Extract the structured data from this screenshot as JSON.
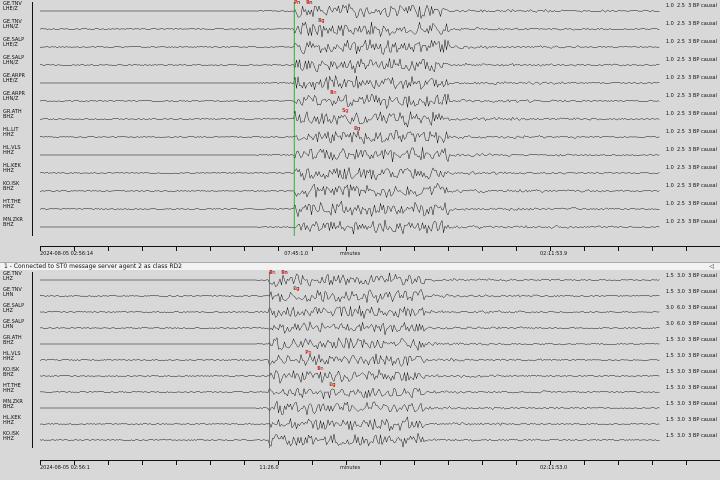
{
  "status_text": "1 - Connected to ST0 message server agent 2 as class RD2",
  "close_glyph": "◁",
  "top": {
    "rows": [
      {
        "label": "GE.TNV\nLHE/Z",
        "scale": "1.0  2.5  3 BP causal"
      },
      {
        "label": "GE.TNV\nLHN/Z",
        "scale": "1.0  2.5  3 BP causal"
      },
      {
        "label": "GE.SALP\nLHE/Z",
        "scale": "1.0  2.5  3 BP causal"
      },
      {
        "label": "GE.SALP\nLHN/Z",
        "scale": "1.0  2.5  3 BP causal"
      },
      {
        "label": "GE.ARPR\nLHE/Z",
        "scale": "1.0  2.5  3 BP causal"
      },
      {
        "label": "GE.ARPR\nLHN/Z",
        "scale": "1.0  2.5  3 BP causal"
      },
      {
        "label": "GR.ATH\nBHZ",
        "scale": "1.0  2.5  3 BP causal"
      },
      {
        "label": "HL.LIT\nHHZ",
        "scale": "1.0  2.5  3 BP causal"
      },
      {
        "label": "HL.VLS\nHHZ",
        "scale": "1.0  2.5  3 BP causal"
      },
      {
        "label": "HL.KEK\nHHZ",
        "scale": "1.0  2.5  3 BP causal"
      },
      {
        "label": "KO.ISK\nBHZ",
        "scale": "1.0  2.5  3 BP causal"
      },
      {
        "label": "HT.THE\nHHZ",
        "scale": "1.0  2.5  3 BP causal"
      },
      {
        "label": "MN.ZKR\nBHZ",
        "scale": "1.0  2.5  3 BP causal"
      }
    ],
    "picks": [
      "Pn",
      "Pn",
      "Pg",
      "Sn",
      "Sg",
      "Pn",
      "Pn",
      "Sn",
      "Sg",
      "P",
      "S",
      "Lg"
    ],
    "axis": {
      "left": "2024-08-05 02:56:14",
      "center": "minutes",
      "right": "02:11:53.9",
      "marker": "07:45:1.0"
    }
  },
  "bottom": {
    "rows": [
      {
        "label": "GE.TNV\nLHZ",
        "scale": "1.5  3.0  3 BP causal"
      },
      {
        "label": "GE.TNV\nLHN",
        "scale": "1.5  3.0  3 BP causal"
      },
      {
        "label": "GE.SALP\nLHZ",
        "scale": "3.0  6.0  3 BP causal"
      },
      {
        "label": "GE.SALP\nLHN",
        "scale": "3.0  6.0  3 BP causal"
      },
      {
        "label": "GR.ATH\nBHZ",
        "scale": "1.5  3.0  3 BP causal"
      },
      {
        "label": "HL.VLS\nHHZ",
        "scale": "1.5  3.0  3 BP causal"
      },
      {
        "label": "KO.ISK\nBHZ",
        "scale": "1.5  3.0  3 BP causal"
      },
      {
        "label": "HT.THE\nHHZ",
        "scale": "1.5  3.0  3 BP causal"
      },
      {
        "label": "MN.ZKR\nBHZ",
        "scale": "1.5  3.0  3 BP causal"
      },
      {
        "label": "HL.KEK\nHHZ",
        "scale": "1.5  3.0  3 BP causal"
      },
      {
        "label": "KO.ISK\nHHZ",
        "scale": "1.5  3.0  3 BP causal"
      }
    ],
    "picks": [
      "Pn",
      "Pn",
      "Pg",
      "Pn",
      "Pn",
      "Pg",
      "S",
      "Sn",
      "Lg",
      "P",
      "S",
      "Lg",
      "P"
    ],
    "axis": {
      "left": "2024-08-05 02:56:1",
      "center": "minutes",
      "right": "02:11:53.0",
      "marker": "11:26.0"
    }
  },
  "colors": {
    "trace": "#111111",
    "pick_red": "#d00000",
    "pick_green": "#1a7f1a",
    "bg": "#d8d8d8"
  }
}
